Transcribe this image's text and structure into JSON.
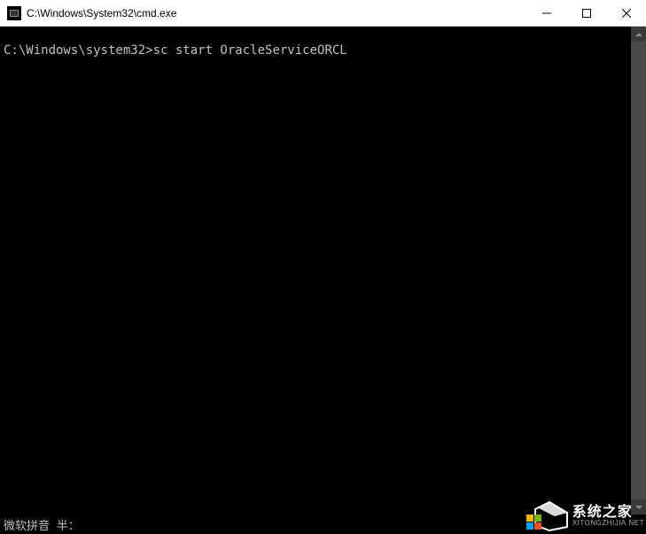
{
  "titlebar": {
    "title": "C:\\Windows\\System32\\cmd.exe",
    "minimize": "—",
    "maximize": "□",
    "close": "×"
  },
  "terminal": {
    "prompt": "C:\\Windows\\system32>",
    "command": "sc start OracleServiceORCL"
  },
  "statusbar": {
    "ime": "微软拼音 半："
  },
  "watermark": {
    "main": "系统之家",
    "sub": "XITONGZHIJIA.NET"
  }
}
